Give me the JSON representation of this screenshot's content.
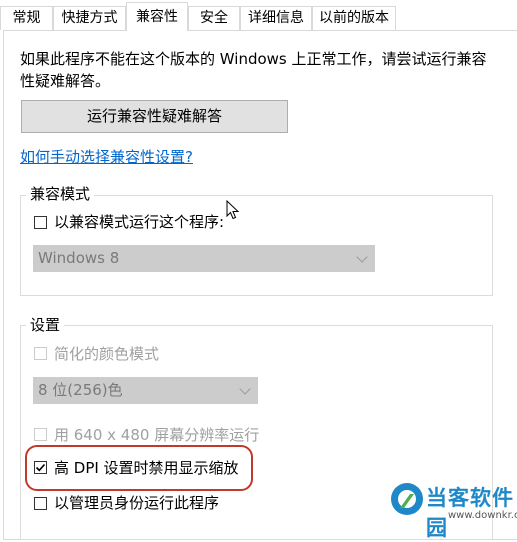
{
  "tabs": [
    {
      "label": "常规",
      "active": false
    },
    {
      "label": "快捷方式",
      "active": false
    },
    {
      "label": "兼容性",
      "active": true
    },
    {
      "label": "安全",
      "active": false
    },
    {
      "label": "详细信息",
      "active": false
    },
    {
      "label": "以前的版本",
      "active": false
    }
  ],
  "intro": {
    "line1": "如果此程序不能在这个版本的 Windows 上正常工作，请尝试运行兼容",
    "line2": "性疑难解答。"
  },
  "troubleshoot_button": "运行兼容性疑难解答",
  "manual_link": "如何手动选择兼容性设置?",
  "compat_mode": {
    "legend": "兼容模式",
    "checkbox_label": "以兼容模式运行这个程序:",
    "checked": false,
    "os_select_value": "Windows 8"
  },
  "settings": {
    "legend": "设置",
    "reduced_color_label": "简化的颜色模式",
    "color_select_value": "8 位(256)色",
    "resolution_label": "用 640 x 480 屏幕分辨率运行",
    "dpi_label": "高 DPI 设置时禁用显示缩放",
    "dpi_checked": true,
    "admin_label": "以管理员身份运行此程序",
    "admin_checked": false
  },
  "watermark": {
    "brand": "当客软件园",
    "url": "www.downkr.com"
  },
  "colors": {
    "link": "#0066cc",
    "highlight": "#c0392b",
    "brand": "#1e88c8"
  }
}
